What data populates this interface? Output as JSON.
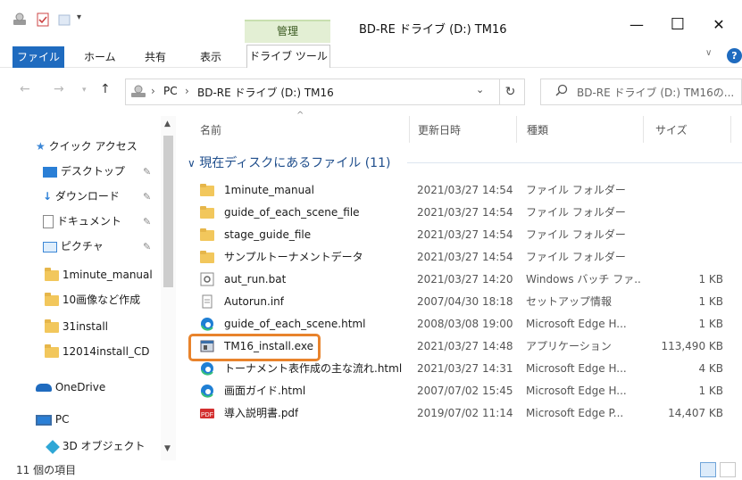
{
  "window": {
    "title": "BD-RE ドライブ (D:) TM16",
    "context_tab": "管理",
    "min": "—",
    "max": "☐",
    "close": "✕"
  },
  "ribbon": {
    "tabs": [
      "ファイル",
      "ホーム",
      "共有",
      "表示",
      "ドライブ ツール"
    ],
    "help": "?",
    "expand": "∨"
  },
  "address": {
    "path": [
      "PC",
      "BD-RE ドライブ (D:) TM16"
    ],
    "search_placeholder": "BD-RE ドライブ (D:) TM16の..."
  },
  "nav_pane": {
    "quick_access": "クイック アクセス",
    "items": [
      {
        "label": "デスクトップ",
        "pinned": true,
        "icon": "desktop-icon"
      },
      {
        "label": "ダウンロード",
        "pinned": true,
        "icon": "download-icon"
      },
      {
        "label": "ドキュメント",
        "pinned": true,
        "icon": "document-icon"
      },
      {
        "label": "ピクチャ",
        "pinned": true,
        "icon": "picture-icon"
      },
      {
        "label": "1minute_manual",
        "pinned": false,
        "icon": "folder-icon"
      },
      {
        "label": "10画像など作成",
        "pinned": false,
        "icon": "folder-icon"
      },
      {
        "label": "31install",
        "pinned": false,
        "icon": "folder-icon"
      },
      {
        "label": "12014install_CD",
        "pinned": false,
        "icon": "folder-icon"
      }
    ],
    "onedrive": "OneDrive",
    "pc": "PC",
    "objects3d": "3D オブジェクト"
  },
  "columns": {
    "name": "名前",
    "date": "更新日時",
    "type": "種類",
    "size": "サイズ"
  },
  "group_header": "現在ディスクにあるファイル (11)",
  "files": [
    {
      "name": "1minute_manual",
      "date": "2021/03/27 14:54",
      "type": "ファイル フォルダー",
      "size": "",
      "icon": "folder"
    },
    {
      "name": "guide_of_each_scene_file",
      "date": "2021/03/27 14:54",
      "type": "ファイル フォルダー",
      "size": "",
      "icon": "folder"
    },
    {
      "name": "stage_guide_file",
      "date": "2021/03/27 14:54",
      "type": "ファイル フォルダー",
      "size": "",
      "icon": "folder"
    },
    {
      "name": "サンプルトーナメントデータ",
      "date": "2021/03/27 14:54",
      "type": "ファイル フォルダー",
      "size": "",
      "icon": "folder"
    },
    {
      "name": "aut_run.bat",
      "date": "2021/03/27 14:20",
      "type": "Windows バッチ ファ...",
      "size": "1 KB",
      "icon": "batch"
    },
    {
      "name": "Autorun.inf",
      "date": "2007/04/30 18:18",
      "type": "セットアップ情報",
      "size": "1 KB",
      "icon": "inf"
    },
    {
      "name": "guide_of_each_scene.html",
      "date": "2008/03/08 19:00",
      "type": "Microsoft Edge H...",
      "size": "1 KB",
      "icon": "edge"
    },
    {
      "name": "TM16_install.exe",
      "date": "2021/03/27 14:48",
      "type": "アプリケーション",
      "size": "113,490 KB",
      "icon": "exe"
    },
    {
      "name": "トーナメント表作成の主な流れ.html",
      "date": "2021/03/27 14:31",
      "type": "Microsoft Edge H...",
      "size": "4 KB",
      "icon": "edge"
    },
    {
      "name": "画面ガイド.html",
      "date": "2007/07/02 15:45",
      "type": "Microsoft Edge H...",
      "size": "1 KB",
      "icon": "edge"
    },
    {
      "name": "導入説明書.pdf",
      "date": "2019/07/02 11:14",
      "type": "Microsoft Edge P...",
      "size": "14,407 KB",
      "icon": "pdf"
    }
  ],
  "status": {
    "count": "11 個の項目"
  },
  "colors": {
    "accent": "#1f6bbf",
    "highlight": "#e8832c",
    "folder": "#f2c75c"
  }
}
